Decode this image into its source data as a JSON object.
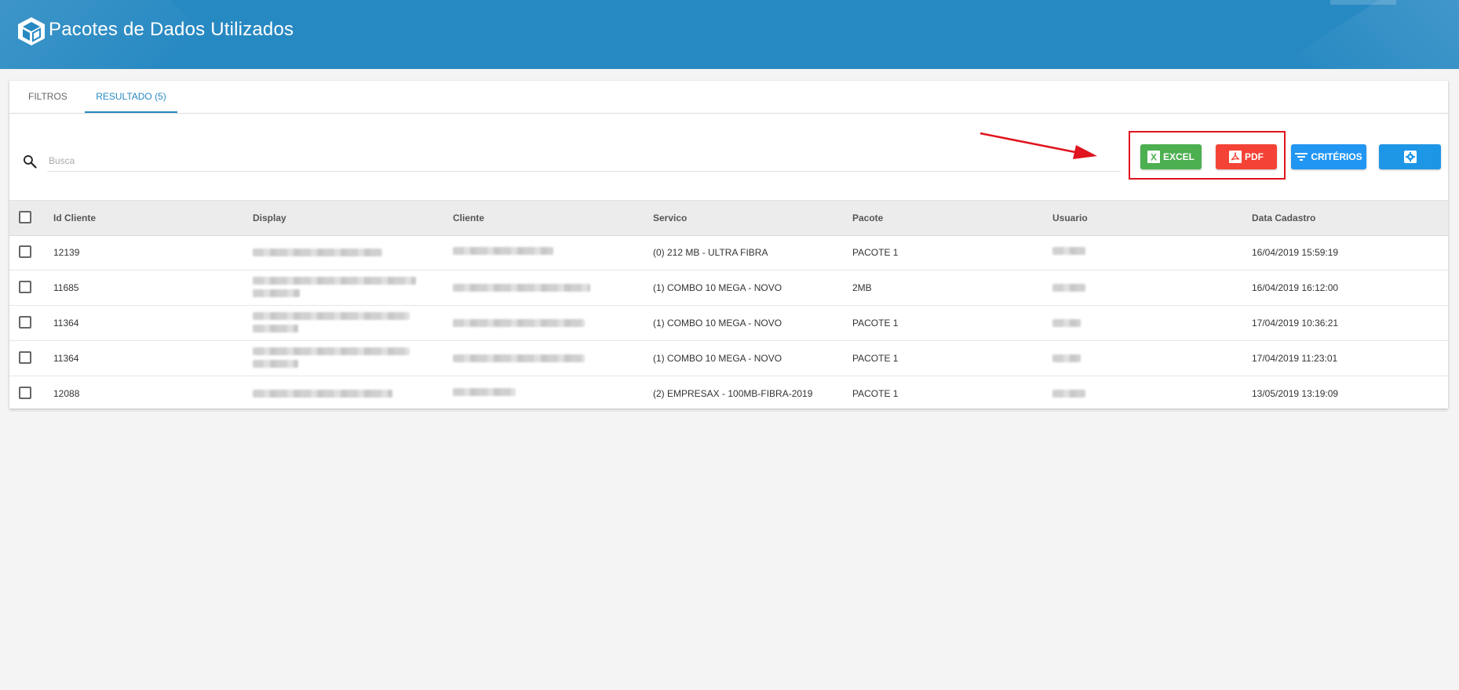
{
  "header": {
    "title": "Pacotes de Dados Utilizados",
    "bg_color": "#2789c2"
  },
  "tabs": [
    {
      "label": "FILTROS",
      "active": false
    },
    {
      "label": "RESULTADO (5)",
      "active": true
    }
  ],
  "search": {
    "placeholder": "Busca",
    "value": "",
    "icon": "search-icon"
  },
  "toolbar": {
    "excel_label": "EXCEL",
    "pdf_label": "PDF",
    "criterios_label": "CRITÉRIOS",
    "settings_icon": "gear-icon",
    "excel_color": "#4caf50",
    "pdf_color": "#f44336",
    "criterios_color": "#2196f3"
  },
  "table": {
    "columns": [
      "Id Cliente",
      "Display",
      "Cliente",
      "Servico",
      "Pacote",
      "Usuario",
      "Data Cadastro"
    ],
    "rows": [
      {
        "id_cliente": "12139",
        "servico": "(0) 212 MB - ULTRA FIBRA",
        "pacote": "PACOTE 1",
        "data_cadastro": "16/04/2019 15:59:19"
      },
      {
        "id_cliente": "11685",
        "servico": "(1) COMBO 10 MEGA - NOVO",
        "pacote": "2MB",
        "data_cadastro": "16/04/2019 16:12:00"
      },
      {
        "id_cliente": "11364",
        "servico": "(1) COMBO 10 MEGA - NOVO",
        "pacote": "PACOTE 1",
        "data_cadastro": "17/04/2019 10:36:21"
      },
      {
        "id_cliente": "11364",
        "servico": "(1) COMBO 10 MEGA - NOVO",
        "pacote": "PACOTE 1",
        "data_cadastro": "17/04/2019 11:23:01"
      },
      {
        "id_cliente": "12088",
        "servico": "(2) EMPRESAX - 100MB-FIBRA-2019",
        "pacote": "PACOTE 1",
        "data_cadastro": "13/05/2019 13:19:09"
      }
    ]
  },
  "annotation": {
    "highlight_color": "#e0141e"
  }
}
